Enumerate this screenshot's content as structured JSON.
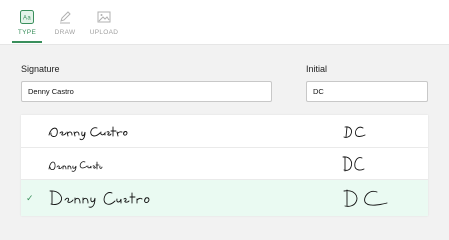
{
  "tabs": [
    {
      "label": "TYPE",
      "icon": "type-icon",
      "active": true
    },
    {
      "label": "DRAW",
      "icon": "pen-icon",
      "active": false
    },
    {
      "label": "UPLOAD",
      "icon": "image-icon",
      "active": false
    }
  ],
  "signature": {
    "label": "Signature",
    "value": "Denny Castro"
  },
  "initial": {
    "label": "Initial",
    "value": "DC"
  },
  "options": [
    {
      "style": "script-1",
      "selected": false
    },
    {
      "style": "script-2",
      "selected": false
    },
    {
      "style": "script-3",
      "selected": true
    }
  ],
  "colors": {
    "accent": "#3a8f5c",
    "selected_bg": "#eafaf2"
  }
}
